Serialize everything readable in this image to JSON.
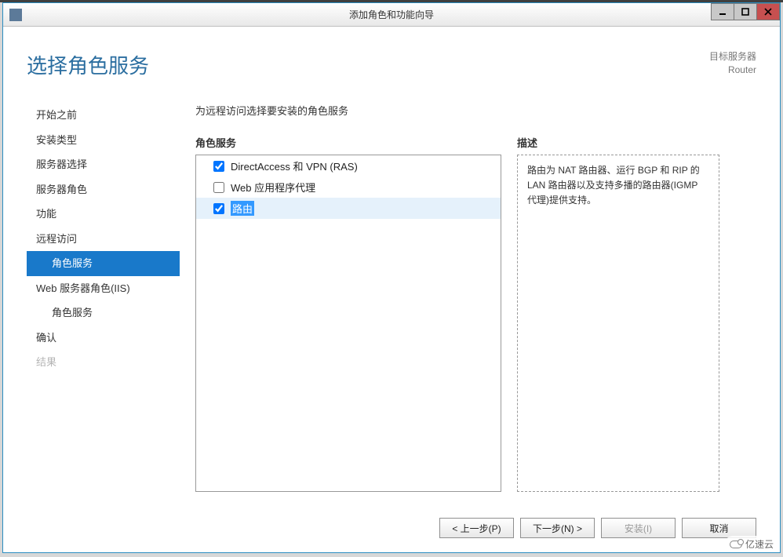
{
  "window": {
    "title": "添加角色和功能向导"
  },
  "header": {
    "heading": "选择角色服务",
    "target_label": "目标服务器",
    "target_name": "Router"
  },
  "sidebar": {
    "items": [
      {
        "label": "开始之前",
        "selected": false,
        "disabled": false,
        "indent": false
      },
      {
        "label": "安装类型",
        "selected": false,
        "disabled": false,
        "indent": false
      },
      {
        "label": "服务器选择",
        "selected": false,
        "disabled": false,
        "indent": false
      },
      {
        "label": "服务器角色",
        "selected": false,
        "disabled": false,
        "indent": false
      },
      {
        "label": "功能",
        "selected": false,
        "disabled": false,
        "indent": false
      },
      {
        "label": "远程访问",
        "selected": false,
        "disabled": false,
        "indent": false
      },
      {
        "label": "角色服务",
        "selected": true,
        "disabled": false,
        "indent": true
      },
      {
        "label": "Web 服务器角色(IIS)",
        "selected": false,
        "disabled": false,
        "indent": false
      },
      {
        "label": "角色服务",
        "selected": false,
        "disabled": false,
        "indent": true
      },
      {
        "label": "确认",
        "selected": false,
        "disabled": false,
        "indent": false
      },
      {
        "label": "结果",
        "selected": false,
        "disabled": true,
        "indent": false
      }
    ]
  },
  "main": {
    "instruction": "为远程访问选择要安装的角色服务",
    "roles_label": "角色服务",
    "desc_label": "描述",
    "roles": [
      {
        "label": "DirectAccess 和 VPN (RAS)",
        "checked": true,
        "highlighted": false
      },
      {
        "label": "Web 应用程序代理",
        "checked": false,
        "highlighted": false
      },
      {
        "label": "路由",
        "checked": true,
        "highlighted": true
      }
    ],
    "description": "路由为 NAT 路由器、运行 BGP 和 RIP 的 LAN 路由器以及支持多播的路由器(IGMP 代理)提供支持。"
  },
  "footer": {
    "prev": "< 上一步(P)",
    "next": "下一步(N) >",
    "install": "安装(I)",
    "cancel": "取消"
  },
  "watermark": "亿速云"
}
